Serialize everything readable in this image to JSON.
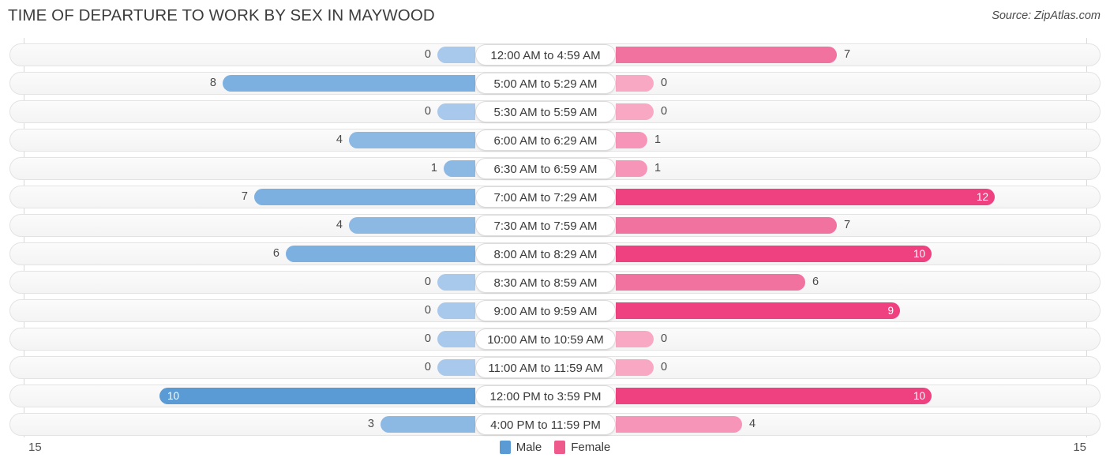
{
  "header": {
    "title": "TIME OF DEPARTURE TO WORK BY SEX IN MAYWOOD",
    "source": "Source: ZipAtlas.com"
  },
  "axis": {
    "left_max": "15",
    "right_max": "15"
  },
  "legend": {
    "items": [
      {
        "label": "Male",
        "color": "#5b9bd5"
      },
      {
        "label": "Female",
        "color": "#ef5a8c"
      }
    ]
  },
  "palette": {
    "male_zero": "#a8c8ec",
    "male_low": "#8cb8e4",
    "male_mid": "#7cb0e0",
    "male_high": "#5b9bd5",
    "female_zero": "#f9a8c4",
    "female_low": "#f795b8",
    "female_mid": "#f2729f",
    "female_high": "#ef417f"
  },
  "chart_data": {
    "type": "bar",
    "title": "TIME OF DEPARTURE TO WORK BY SEX IN MAYWOOD",
    "xlabel": "",
    "ylabel": "",
    "orientation": "horizontal-diverging",
    "xlim": [
      15,
      15
    ],
    "grid": true,
    "legend_position": "bottom-center",
    "categories": [
      "12:00 AM to 4:59 AM",
      "5:00 AM to 5:29 AM",
      "5:30 AM to 5:59 AM",
      "6:00 AM to 6:29 AM",
      "6:30 AM to 6:59 AM",
      "7:00 AM to 7:29 AM",
      "7:30 AM to 7:59 AM",
      "8:00 AM to 8:29 AM",
      "8:30 AM to 8:59 AM",
      "9:00 AM to 9:59 AM",
      "10:00 AM to 10:59 AM",
      "11:00 AM to 11:59 AM",
      "12:00 PM to 3:59 PM",
      "4:00 PM to 11:59 PM"
    ],
    "series": [
      {
        "name": "Male",
        "values": [
          0,
          8,
          0,
          4,
          1,
          7,
          4,
          6,
          0,
          0,
          0,
          0,
          10,
          3
        ]
      },
      {
        "name": "Female",
        "values": [
          7,
          0,
          0,
          1,
          1,
          12,
          7,
          10,
          6,
          9,
          0,
          0,
          10,
          4
        ]
      }
    ]
  }
}
